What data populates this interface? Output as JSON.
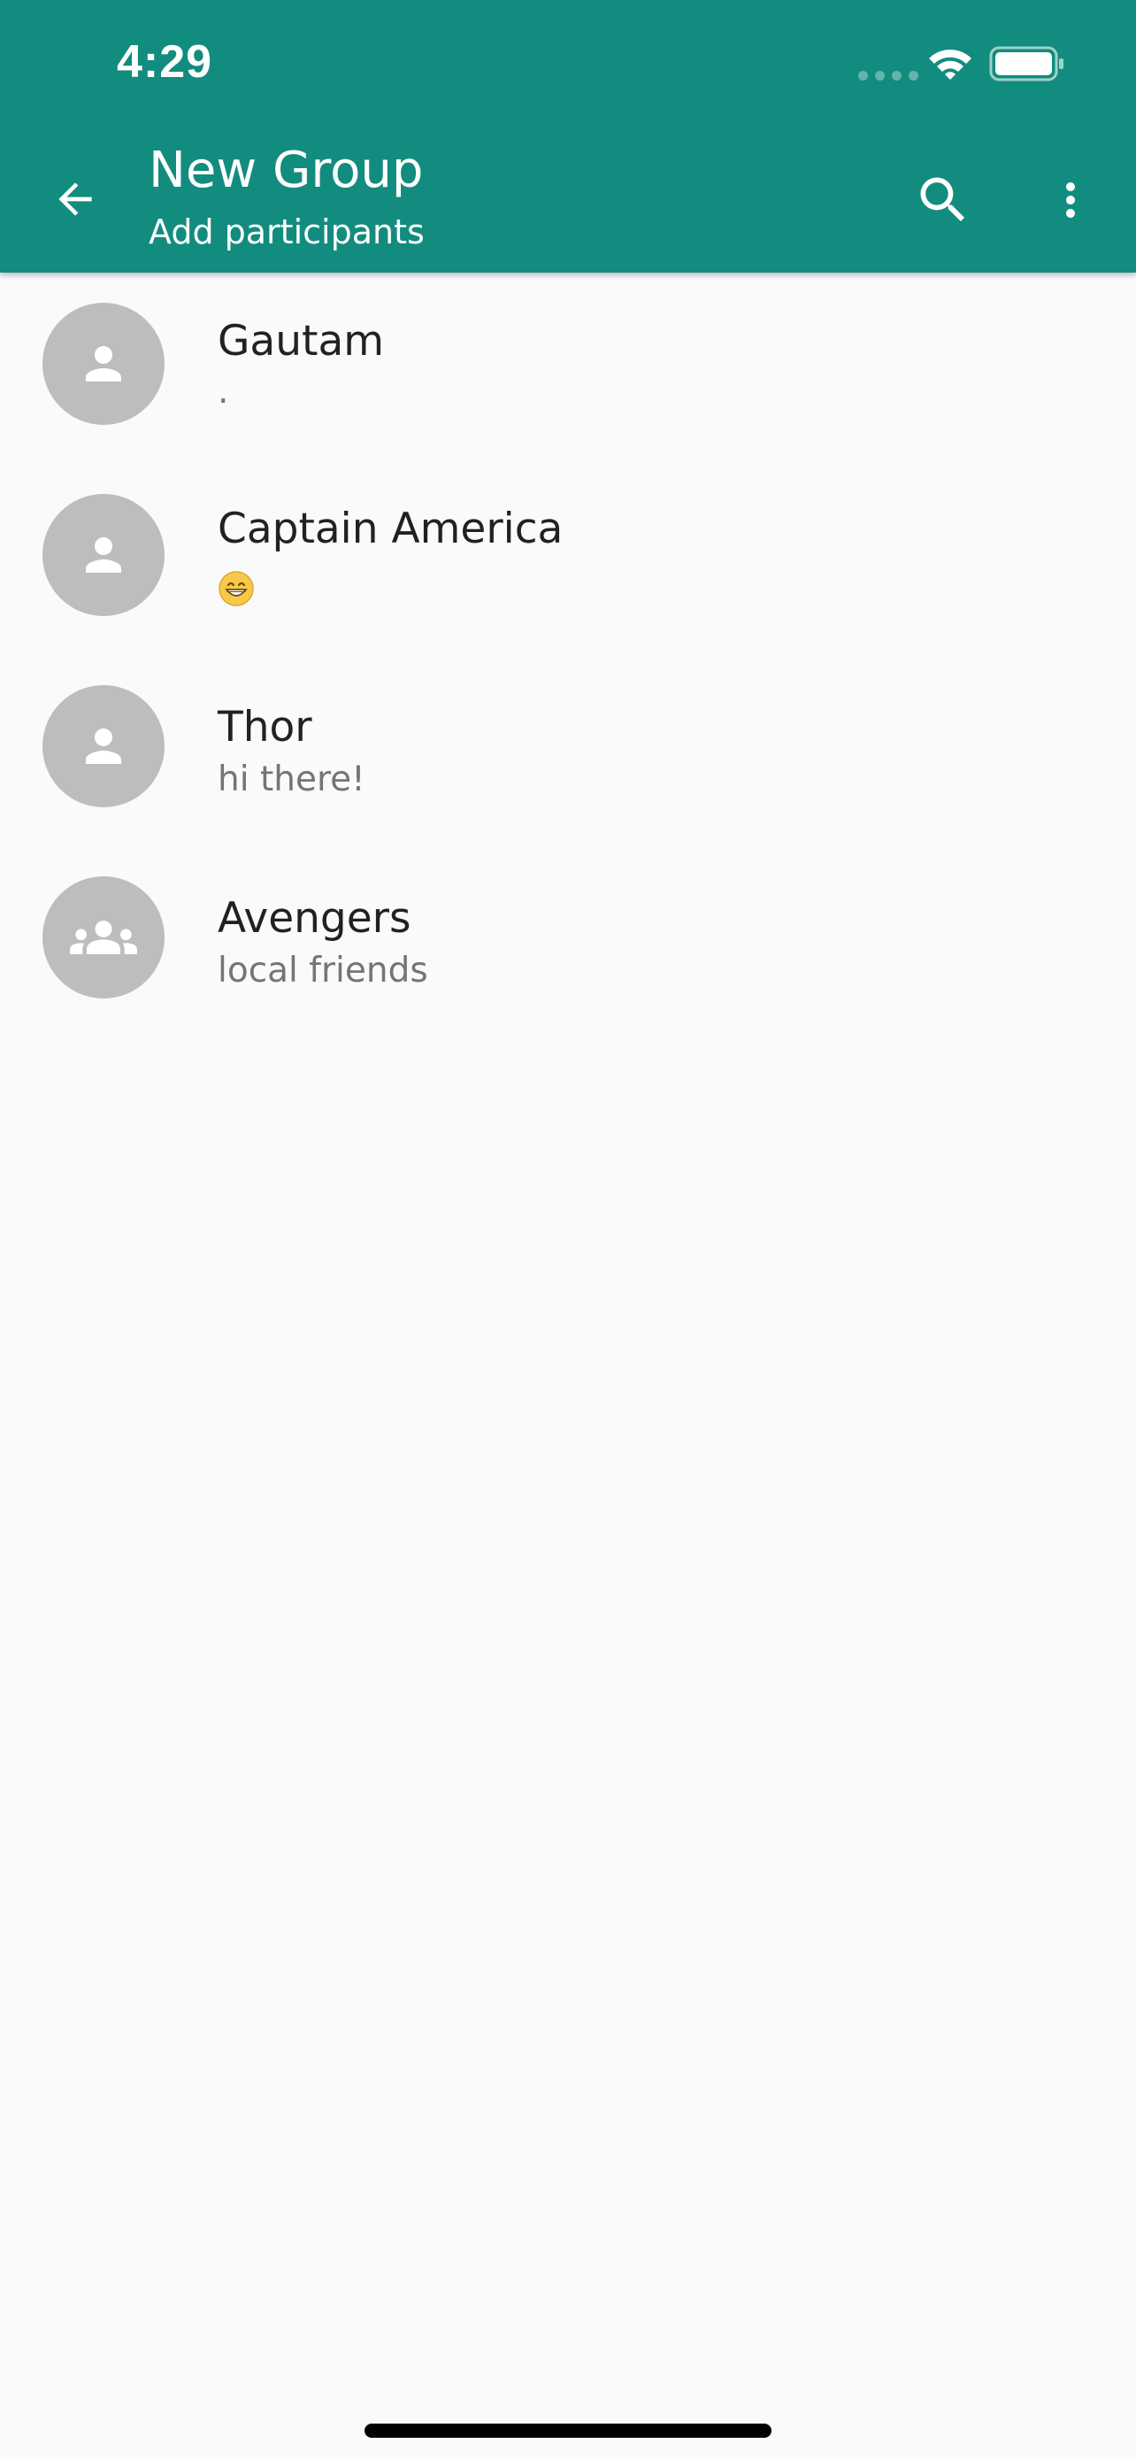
{
  "status_bar": {
    "time": "4:29"
  },
  "app_bar": {
    "title": "New Group",
    "subtitle": "Add participants",
    "icons": {
      "back": "arrow-back-icon",
      "search": "search-icon",
      "more": "more-vert-icon"
    }
  },
  "colors": {
    "primary": "#128c7e",
    "background": "#fafafa",
    "avatar_bg": "#bdbdbd",
    "name_text": "#212121",
    "status_text": "#757575"
  },
  "contacts": [
    {
      "name": "Gautam",
      "status": ".",
      "avatar": "person-icon"
    },
    {
      "name": "Captain America",
      "status": "😁",
      "avatar": "person-icon"
    },
    {
      "name": "Thor",
      "status": "hi there!",
      "avatar": "person-icon"
    },
    {
      "name": "Avengers",
      "status": "local friends",
      "avatar": "group-icon"
    }
  ]
}
